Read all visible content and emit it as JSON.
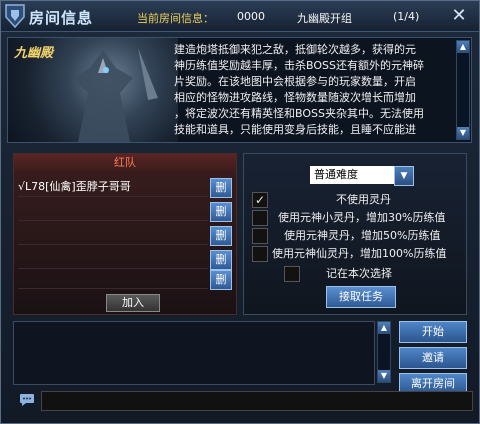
{
  "header": {
    "title": "房间信息",
    "info_label": "当前房间信息：",
    "room_id": "0000",
    "room_name": "九幽殿开组",
    "player_count": "(1/4)",
    "close_icon": "close-icon"
  },
  "banner": {
    "map_name": "九幽殿",
    "description_lines": [
      "建造炮塔抵御来犯之敌，抵御轮次越多，获得的元",
      "神历练值奖励越丰厚，击杀BOSS还有额外的元神碎",
      "片奖励。在该地图中会根据参与的玩家数量，开启",
      "相应的怪物进攻路线，怪物数量随波次增长而增加",
      "，将定波次还有精英怪和BOSS夹杂其中。无法使用",
      "技能和道具，只能使用变身后技能，且睡不应能进"
    ]
  },
  "team": {
    "title": "红队",
    "slots": [
      "√L78[仙禽]歪脖子哥哥",
      "",
      "",
      "",
      ""
    ],
    "delete_label": "删",
    "join_label": "加入"
  },
  "options": {
    "difficulty": "普通难度",
    "items": [
      {
        "label": "不使用灵丹",
        "checked": true
      },
      {
        "label": "使用元神小灵丹，增加30%历练值",
        "checked": false
      },
      {
        "label": "使用元神灵丹，增加50%历练值",
        "checked": false
      },
      {
        "label": "使用元神仙灵丹，增加100%历练值",
        "checked": false
      }
    ],
    "remember_label": "记在本次选择",
    "accept_label": "接取任务"
  },
  "actions": {
    "start": "开始",
    "invite": "邀请",
    "leave": "离开房间"
  },
  "colors": {
    "gold": "#f0d25a",
    "red_team": "#ff7a5a",
    "button_blue": "#2f5a94"
  }
}
